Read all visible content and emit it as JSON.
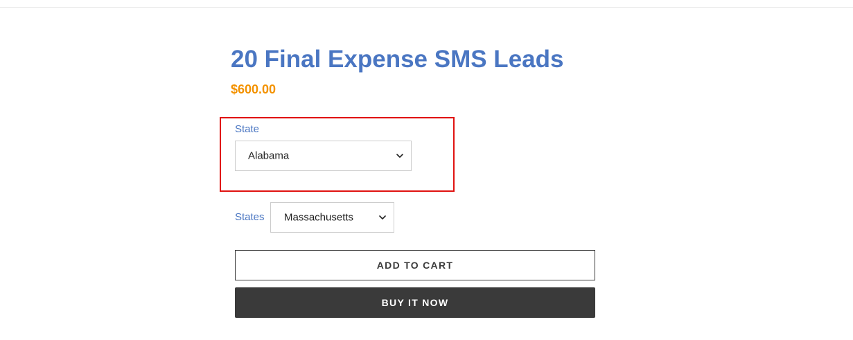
{
  "product": {
    "title": "20 Final Expense SMS Leads",
    "price": "$600.00"
  },
  "options": {
    "state": {
      "label": "State",
      "selected": "Alabama"
    },
    "states": {
      "label": "States",
      "selected": "Massachusetts"
    }
  },
  "actions": {
    "add_to_cart": "ADD TO CART",
    "buy_it_now": "BUY IT NOW"
  },
  "icons": {
    "dropdown": "chevron-down-icon"
  },
  "colors": {
    "title": "#4a76c2",
    "price": "#f39200",
    "label": "#4a76c2",
    "highlight": "#e0110f",
    "button_dark": "#3a3a3a"
  }
}
